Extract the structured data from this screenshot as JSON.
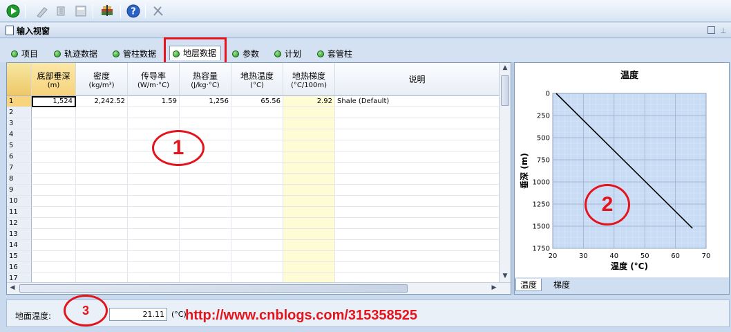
{
  "window": {
    "title": "输入视窗"
  },
  "tabs": [
    {
      "label": "项目"
    },
    {
      "label": "轨迹数据"
    },
    {
      "label": "管柱数据"
    },
    {
      "label": "地层数据",
      "active": true
    },
    {
      "label": "参数"
    },
    {
      "label": "计划"
    },
    {
      "label": "套管柱"
    }
  ],
  "grid": {
    "columns": [
      {
        "label": "底部垂深",
        "unit": "(m)"
      },
      {
        "label": "密度",
        "unit": "(kg/m³)"
      },
      {
        "label": "传导率",
        "unit": "(W/m·°C)"
      },
      {
        "label": "热容量",
        "unit": "(J/kg·°C)"
      },
      {
        "label": "地热温度",
        "unit": "(°C)"
      },
      {
        "label": "地热梯度",
        "unit": "(°C/100m)"
      },
      {
        "label": "说明",
        "unit": ""
      }
    ],
    "rows": [
      [
        "1,524",
        "2,242.52",
        "1.59",
        "1,256",
        "65.56",
        "2.92",
        "Shale (Default)"
      ]
    ],
    "row_numbers": [
      "1",
      "2",
      "3",
      "4",
      "5",
      "6",
      "7",
      "8",
      "9",
      "10",
      "11",
      "12",
      "13",
      "14",
      "15",
      "16",
      "17"
    ]
  },
  "annotations": {
    "circle1": "1",
    "circle2": "2",
    "circle3": "3",
    "watermark": "http://www.cnblogs.com/315358525"
  },
  "chart_tabs": [
    {
      "label": "温度",
      "active": true
    },
    {
      "label": "梯度"
    }
  ],
  "surface": {
    "label": "地面温度:",
    "value": "21.11",
    "unit": "(°C)"
  },
  "colors": {
    "accent_red": "#e3141c",
    "header_yellow": "#f6d37c",
    "gradient_column": "#fefcd4",
    "plot_bg": "#c9dcf5"
  },
  "toolbar_icons": [
    "play-icon",
    "measure-icon",
    "tools-icon",
    "calculator-icon",
    "layers-icon",
    "help-icon",
    "disabled-tool-icon"
  ],
  "chart_data": {
    "type": "line",
    "title": "温度",
    "xlabel": "温度 (°C)",
    "ylabel": "垂深 (m)",
    "xlim": [
      20,
      70
    ],
    "ylim": [
      0,
      1750
    ],
    "y_inverted": true,
    "x_ticks": [
      "20",
      "30",
      "40",
      "50",
      "60",
      "70"
    ],
    "y_ticks": [
      "0",
      "250",
      "500",
      "750",
      "1000",
      "1250",
      "1500",
      "1750"
    ],
    "grid": true,
    "series": [
      {
        "x": [
          21.11,
          65.56
        ],
        "y": [
          0,
          1524
        ]
      }
    ]
  }
}
